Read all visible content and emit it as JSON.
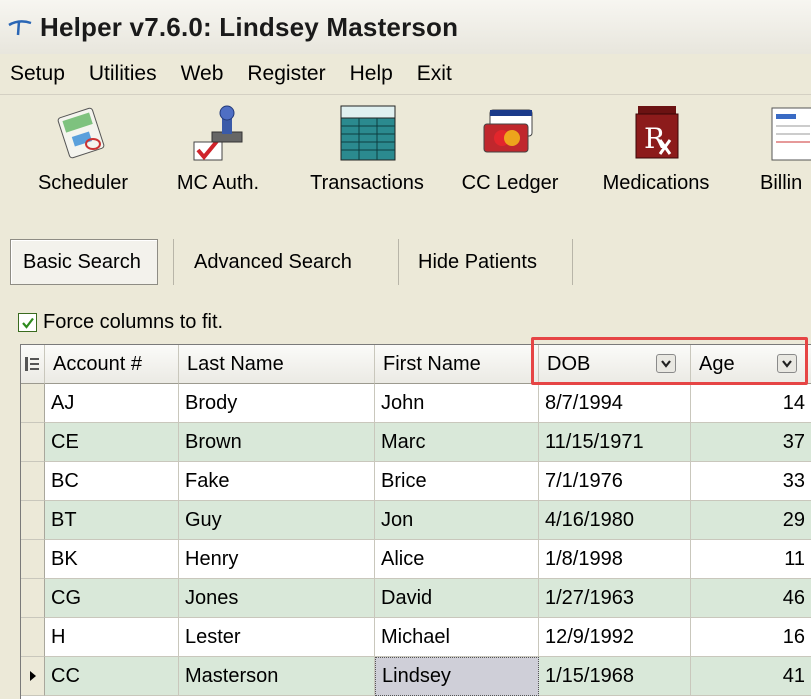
{
  "window": {
    "title": "Helper v7.6.0: Lindsey Masterson"
  },
  "menu": [
    "Setup",
    "Utilities",
    "Web",
    "Register",
    "Help",
    "Exit"
  ],
  "toolbar": {
    "scheduler": "Scheduler",
    "mc_auth": "MC Auth.",
    "transactions": "Transactions",
    "cc_ledger": "CC Ledger",
    "medications": "Medications",
    "billing": "Billin"
  },
  "tabs": {
    "basic": "Basic Search",
    "advanced": "Advanced Search",
    "hide": "Hide Patients"
  },
  "force_fit": {
    "label": "Force columns to fit.",
    "checked": true
  },
  "grid": {
    "headers": {
      "account": "Account #",
      "last": "Last Name",
      "first": "First Name",
      "dob": "DOB",
      "age": "Age"
    },
    "rows": [
      {
        "account": "AJ",
        "last": "Brody",
        "first": "John",
        "dob": "8/7/1994",
        "age": "14"
      },
      {
        "account": "CE",
        "last": "Brown",
        "first": "Marc",
        "dob": "11/15/1971",
        "age": "37"
      },
      {
        "account": "BC",
        "last": "Fake",
        "first": "Brice",
        "dob": "7/1/1976",
        "age": "33"
      },
      {
        "account": "BT",
        "last": "Guy",
        "first": "Jon",
        "dob": "4/16/1980",
        "age": "29"
      },
      {
        "account": "BK",
        "last": "Henry",
        "first": "Alice",
        "dob": "1/8/1998",
        "age": "11"
      },
      {
        "account": "CG",
        "last": "Jones",
        "first": "David",
        "dob": "1/27/1963",
        "age": "46"
      },
      {
        "account": "H",
        "last": "Lester",
        "first": "Michael",
        "dob": "12/9/1992",
        "age": "16"
      },
      {
        "account": "CC",
        "last": "Masterson",
        "first": "Lindsey",
        "dob": "1/15/1968",
        "age": "41"
      }
    ],
    "alt_row_color": "#d9e8d9",
    "highlight_color": "#e64545"
  }
}
